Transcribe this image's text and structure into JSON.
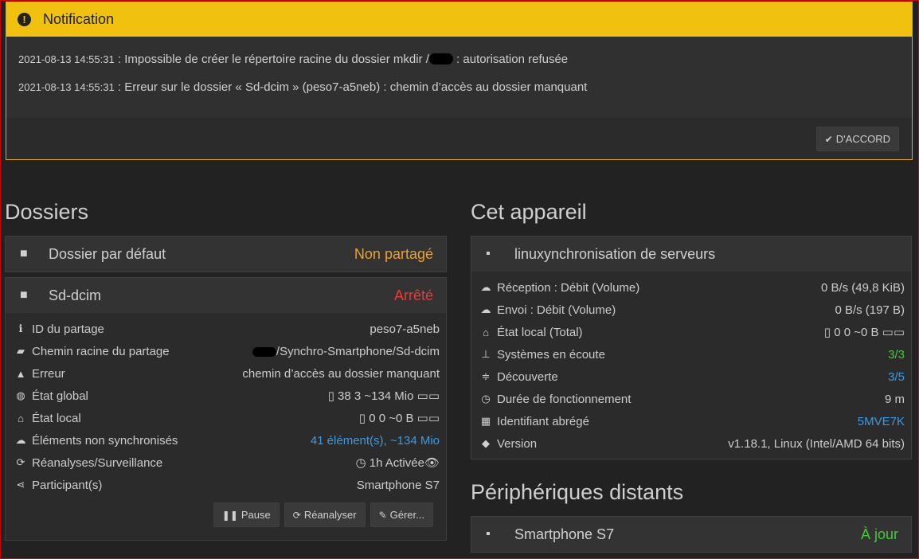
{
  "notification": {
    "title": "Notification",
    "lines": [
      {
        "ts": "2021-08-13 14:55:31",
        "pre": " : Impossible de créer le répertoire racine du dossier mkdir /",
        "post": " : autorisation refusée"
      },
      {
        "ts": "2021-08-13 14:55:31",
        "pre": " : Erreur sur le dossier « Sd-dcim » (peso7-a5neb) : chemin d’accès au dossier manquant",
        "post": ""
      }
    ],
    "ok_label": "D'ACCORD"
  },
  "folders": {
    "heading": "Dossiers",
    "default_folder": {
      "name": "Dossier par défaut",
      "status": "Non partagé"
    },
    "sd_folder": {
      "name": "Sd-dcim",
      "status": "Arrêté",
      "rows": [
        {
          "label": "ID du partage",
          "value": "peso7-a5neb"
        },
        {
          "label": "Chemin racine du partage",
          "value": "/Synchro-Smartphone/Sd-dcim"
        },
        {
          "label": "Erreur",
          "value": "chemin d’accès au dossier manquant"
        },
        {
          "label": "État global",
          "value": "38 3 ~134 Mio"
        },
        {
          "label": "État local",
          "value": "0 0 ~0 B"
        },
        {
          "label": "Éléments non synchronisés",
          "value": "41 élément(s), ~134 Mio"
        },
        {
          "label": "Réanalyses/Surveillance",
          "value": "1h Activée"
        },
        {
          "label": "Participant(s)",
          "value": "Smartphone S7"
        }
      ],
      "buttons": {
        "pause": "Pause",
        "rescan": "Réanalyser",
        "manage": "Gérer..."
      }
    }
  },
  "device": {
    "heading": "Cet appareil",
    "name": "linuxynchronisation de serveurs",
    "rows": [
      {
        "label": "Réception : Débit (Volume)",
        "value": "0 B/s (49,8 KiB)"
      },
      {
        "label": "Envoi : Débit (Volume)",
        "value": "0 B/s (197 B)"
      },
      {
        "label": "État local (Total)",
        "value": "0 0 ~0 B"
      },
      {
        "label": "Systèmes en écoute",
        "value": "3/3"
      },
      {
        "label": "Découverte",
        "value": "3/5"
      },
      {
        "label": "Durée de fonctionnement",
        "value": "9 m"
      },
      {
        "label": "Identifiant abrégé",
        "value": "5MVE7K"
      },
      {
        "label": "Version",
        "value": "v1.18.1, Linux (Intel/AMD 64 bits)"
      }
    ]
  },
  "remote": {
    "heading": "Périphériques distants",
    "device_name": "Smartphone S7",
    "device_status": "À jour"
  }
}
